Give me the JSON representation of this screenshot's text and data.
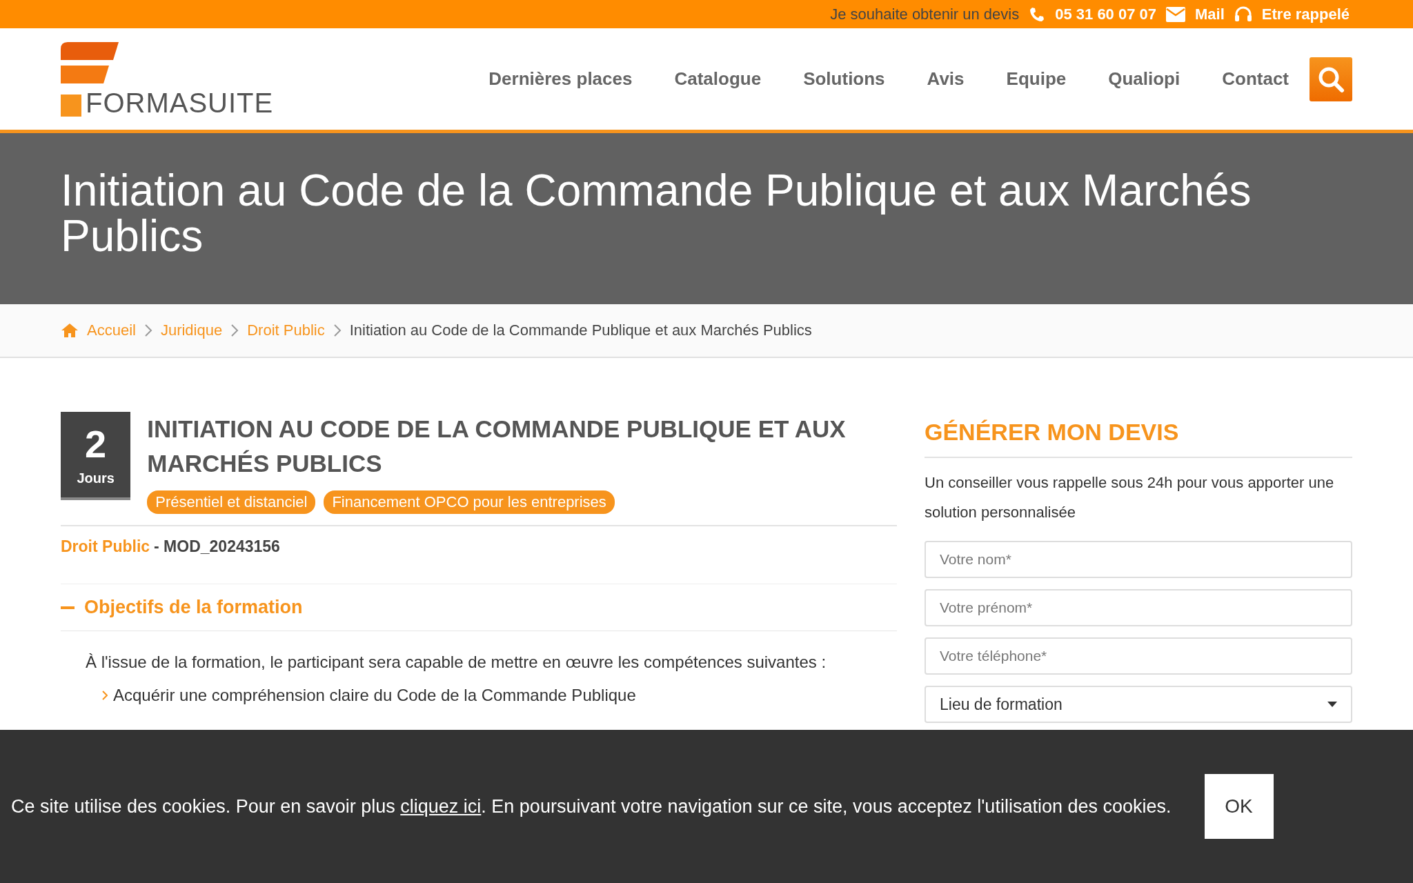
{
  "top_bar": {
    "quote_link": "Je souhaite obtenir un devis",
    "phone": "05 31 60 07 07",
    "mail": "Mail",
    "callback": "Etre rappelé"
  },
  "header": {
    "logo_text": "FORMASUITE",
    "nav": [
      "Dernières places",
      "Catalogue",
      "Solutions",
      "Avis",
      "Equipe",
      "Qualiopi",
      "Contact"
    ]
  },
  "hero": {
    "title": "Initiation au Code de la Commande Publique et aux Marchés Publics"
  },
  "breadcrumb": {
    "links": [
      "Accueil",
      "Juridique",
      "Droit Public"
    ],
    "current": "Initiation au Code de la Commande Publique et aux Marchés Publics"
  },
  "course": {
    "duration_value": "2",
    "duration_unit": "Jours",
    "title": "INITIATION AU CODE DE LA COMMANDE PUBLIQUE ET AUX MARCHÉS PUBLICS",
    "tags": [
      "Présentiel et distanciel",
      "Financement OPCO pour les entreprises"
    ],
    "category": "Droit Public",
    "code": "- MOD_20243156",
    "sections": [
      {
        "title": "Objectifs de la formation",
        "expanded": true,
        "intro": "À l'issue de la formation, le participant sera capable de mettre en œuvre les compétences suivantes :",
        "items": [
          "Acquérir une compréhension claire du Code de la Commande Publique"
        ]
      }
    ]
  },
  "quote_form": {
    "title": "GÉNÉRER MON DEVIS",
    "description": "Un conseiller vous rappelle sous 24h pour vous apporter une solution personnalisée",
    "fields": [
      {
        "kind": "input",
        "placeholder": "Votre nom*"
      },
      {
        "kind": "input",
        "placeholder": "Votre prénom*"
      },
      {
        "kind": "input",
        "placeholder": "Votre téléphone*"
      },
      {
        "kind": "select",
        "value": "Lieu de formation"
      }
    ]
  },
  "cookie_banner": {
    "text_before": "Ce site utilise des cookies. Pour en savoir plus ",
    "link": "cliquez ici",
    "text_after": ". En poursuivant votre navigation sur ce site, vous acceptez l'utilisation des cookies.",
    "button": "OK"
  }
}
